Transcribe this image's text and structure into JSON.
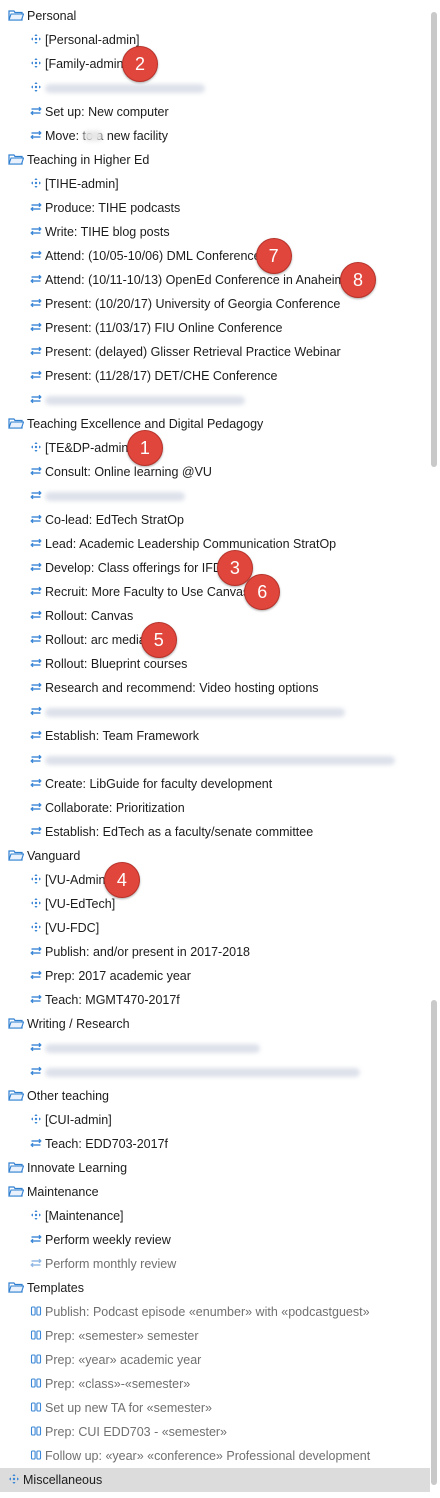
{
  "rows": [
    {
      "kind": "folder",
      "label": "Personal"
    },
    {
      "kind": "item",
      "icon": "action-arrows-icon",
      "label": "[Personal-admin]"
    },
    {
      "kind": "item",
      "icon": "action-arrows-icon",
      "label": "[Family-admin]"
    },
    {
      "kind": "blur",
      "icon": "action-arrows-icon",
      "w": 160
    },
    {
      "kind": "item",
      "icon": "project-icon",
      "label": "Set up: New computer"
    },
    {
      "kind": "item",
      "icon": "project-icon",
      "label": "Move:      to a new facility"
    },
    {
      "kind": "folder",
      "label": "Teaching in Higher Ed"
    },
    {
      "kind": "item",
      "icon": "action-arrows-icon",
      "label": "[TIHE-admin]"
    },
    {
      "kind": "item",
      "icon": "project-icon",
      "label": "Produce: TIHE podcasts"
    },
    {
      "kind": "item",
      "icon": "project-icon",
      "label": "Write: TIHE blog posts"
    },
    {
      "kind": "item",
      "icon": "project-icon",
      "label": "Attend: (10/05-10/06) DML Conference"
    },
    {
      "kind": "item",
      "icon": "project-icon",
      "label": "Attend: (10/11-10/13) OpenEd Conference in Anaheim"
    },
    {
      "kind": "item",
      "icon": "project-icon",
      "label": "Present: (10/20/17) University of Georgia Conference"
    },
    {
      "kind": "item",
      "icon": "project-icon",
      "label": "Present: (11/03/17) FIU Online Conference"
    },
    {
      "kind": "item",
      "icon": "project-icon",
      "label": "Present: (delayed) Glisser Retrieval Practice Webinar"
    },
    {
      "kind": "item",
      "icon": "project-icon",
      "label": "Present: (11/28/17) DET/CHE Conference"
    },
    {
      "kind": "blur",
      "icon": "project-icon",
      "w": 200
    },
    {
      "kind": "folder",
      "label": "Teaching Excellence and Digital Pedagogy"
    },
    {
      "kind": "item",
      "icon": "action-arrows-icon",
      "label": "[TE&DP-admin]"
    },
    {
      "kind": "item",
      "icon": "project-icon",
      "label": "Consult: Online learning @VU"
    },
    {
      "kind": "blur",
      "icon": "project-icon",
      "w": 140
    },
    {
      "kind": "item",
      "icon": "project-icon",
      "label": "Co-lead: EdTech StratOp"
    },
    {
      "kind": "item",
      "icon": "project-icon",
      "label": "Lead: Academic Leadership Communication StratOp"
    },
    {
      "kind": "item",
      "icon": "project-icon",
      "label": "Develop: Class offerings for IFD"
    },
    {
      "kind": "item",
      "icon": "project-icon",
      "label": "Recruit: More Faculty to Use Canvas"
    },
    {
      "kind": "item",
      "icon": "project-icon",
      "label": "Rollout: Canvas"
    },
    {
      "kind": "item",
      "icon": "project-icon",
      "label": "Rollout: arc media"
    },
    {
      "kind": "item",
      "icon": "project-icon",
      "label": "Rollout: Blueprint courses"
    },
    {
      "kind": "item",
      "icon": "project-icon",
      "label": "Research and recommend: Video hosting options"
    },
    {
      "kind": "blur",
      "icon": "project-icon",
      "w": 300
    },
    {
      "kind": "item",
      "icon": "project-icon",
      "label": "Establish: Team Framework"
    },
    {
      "kind": "blur",
      "icon": "project-icon",
      "w": 350
    },
    {
      "kind": "item",
      "icon": "project-icon",
      "label": "Create: LibGuide for faculty development"
    },
    {
      "kind": "item",
      "icon": "project-icon",
      "label": "Collaborate: Prioritization"
    },
    {
      "kind": "item",
      "icon": "project-icon",
      "label": "Establish: EdTech as a faculty/senate committee"
    },
    {
      "kind": "folder",
      "label": "Vanguard"
    },
    {
      "kind": "item",
      "icon": "action-arrows-icon",
      "label": "[VU-Admin]"
    },
    {
      "kind": "item",
      "icon": "action-arrows-icon",
      "label": "[VU-EdTech]"
    },
    {
      "kind": "item",
      "icon": "action-arrows-icon",
      "label": "[VU-FDC]"
    },
    {
      "kind": "item",
      "icon": "project-icon",
      "label": "Publish: and/or present in 2017-2018"
    },
    {
      "kind": "item",
      "icon": "project-icon",
      "label": "Prep: 2017 academic year"
    },
    {
      "kind": "item",
      "icon": "project-icon",
      "label": "Teach: MGMT470-2017f"
    },
    {
      "kind": "folder",
      "label": "Writing / Research"
    },
    {
      "kind": "blur",
      "icon": "project-icon",
      "w": 215
    },
    {
      "kind": "blur",
      "icon": "project-icon",
      "w": 315
    },
    {
      "kind": "folder",
      "label": "Other teaching"
    },
    {
      "kind": "item",
      "icon": "action-arrows-icon",
      "label": "[CUI-admin]"
    },
    {
      "kind": "item",
      "icon": "project-icon",
      "label": "Teach: EDD703-2017f"
    },
    {
      "kind": "folder",
      "label": "Innovate Learning"
    },
    {
      "kind": "folder",
      "label": "Maintenance"
    },
    {
      "kind": "item",
      "icon": "action-arrows-icon",
      "label": "[Maintenance]"
    },
    {
      "kind": "item",
      "icon": "project-icon",
      "label": "Perform weekly review"
    },
    {
      "kind": "item",
      "icon": "project-icon-muted",
      "label": "Perform monthly review",
      "muted": true
    },
    {
      "kind": "folder",
      "label": "Templates"
    },
    {
      "kind": "item",
      "icon": "template-icon",
      "label": "Publish: Podcast episode «enumber» with «podcastguest»",
      "muted": true
    },
    {
      "kind": "item",
      "icon": "template-icon",
      "label": "Prep: «semester» semester",
      "muted": true
    },
    {
      "kind": "item",
      "icon": "template-icon",
      "label": "Prep: «year» academic year",
      "muted": true
    },
    {
      "kind": "item",
      "icon": "template-icon",
      "label": "Prep: «class»-«semester»",
      "muted": true
    },
    {
      "kind": "item",
      "icon": "template-icon",
      "label": "Set up new TA for «semester»",
      "muted": true
    },
    {
      "kind": "item",
      "icon": "template-icon",
      "label": "Prep: CUI EDD703 - «semester»",
      "muted": true
    },
    {
      "kind": "item",
      "icon": "template-icon",
      "label": "Follow up: «year» «conference» Professional development",
      "muted": true
    },
    {
      "kind": "item",
      "icon": "action-arrows-icon",
      "label": "Miscellaneous",
      "depth0": true,
      "selected": true
    }
  ],
  "badges": [
    {
      "label": "2",
      "row": 2,
      "after": "[Family-admin]"
    },
    {
      "label": "7",
      "row": 10,
      "after": "Attend: (10/05-10/06) DML Conference"
    },
    {
      "label": "8",
      "row": 11,
      "after": "Attend: (10/11-10/13) OpenEd Conference in Anaheim"
    },
    {
      "label": "1",
      "row": 18,
      "after": "[TE&DP-admin]"
    },
    {
      "label": "3",
      "row": 23,
      "after": "Develop: Class offerings for IFD"
    },
    {
      "label": "6",
      "row": 24,
      "after": "Recruit: More Faculty to Use Canvas"
    },
    {
      "label": "5",
      "row": 26,
      "after": "Rollout: arc media"
    },
    {
      "label": "4",
      "row": 36,
      "after": "[VU-Admin]"
    }
  ],
  "colors": {
    "accent": "#2f7fd1",
    "badge": "#e0463c",
    "selected_row": "#dcdcdc"
  }
}
